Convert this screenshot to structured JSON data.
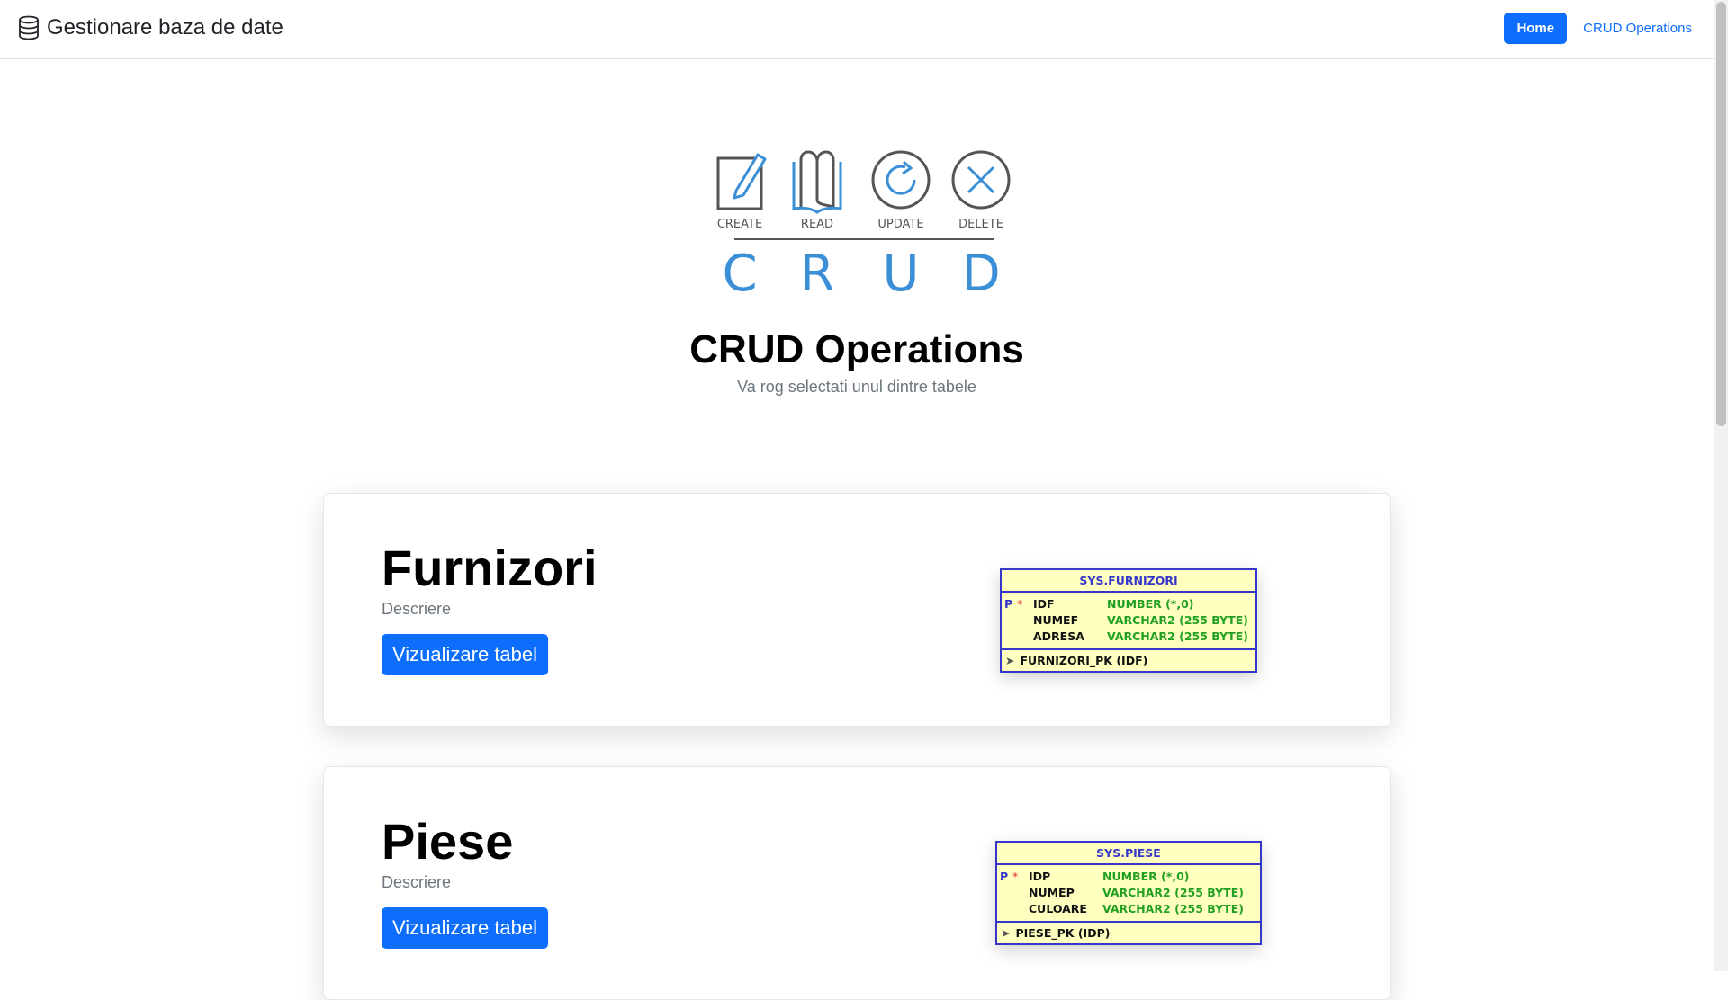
{
  "navbar": {
    "brand": "Gestionare baza de date",
    "brand_icon": "database-icon",
    "links": [
      {
        "label": "Home",
        "active": true
      },
      {
        "label": "CRUD Operations",
        "active": false
      }
    ]
  },
  "hero": {
    "logo": {
      "icons": [
        {
          "name": "pencil-square-icon",
          "label": "CREATE"
        },
        {
          "name": "book-icon",
          "label": "READ"
        },
        {
          "name": "refresh-icon",
          "label": "UPDATE"
        },
        {
          "name": "close-circle-icon",
          "label": "DELETE"
        }
      ],
      "letters": [
        "C",
        "R",
        "U",
        "D"
      ]
    },
    "title": "CRUD Operations",
    "subtitle": "Va rog selectati unul dintre tabele"
  },
  "cards": [
    {
      "title": "Furnizori",
      "description": "Descriere",
      "button": "Vizualizare tabel",
      "diagram": {
        "table": "SYS.FURNIZORI",
        "columns": [
          {
            "key": "P",
            "required": "*",
            "name": "IDF",
            "type": "NUMBER (*,0)"
          },
          {
            "key": "",
            "required": "",
            "name": "NUMEF",
            "type": "VARCHAR2 (255 BYTE)"
          },
          {
            "key": "",
            "required": "",
            "name": "ADRESA",
            "type": "VARCHAR2 (255 BYTE)"
          }
        ],
        "index": "FURNIZORI_PK (IDF)"
      }
    },
    {
      "title": "Piese",
      "description": "Descriere",
      "button": "Vizualizare tabel",
      "diagram": {
        "table": "SYS.PIESE",
        "columns": [
          {
            "key": "P",
            "required": "*",
            "name": "IDP",
            "type": "NUMBER (*,0)"
          },
          {
            "key": "",
            "required": "",
            "name": "NUMEP",
            "type": "VARCHAR2 (255 BYTE)"
          },
          {
            "key": "",
            "required": "",
            "name": "CULOARE",
            "type": "VARCHAR2 (255 BYTE)"
          }
        ],
        "index": "PIESE_PK (IDP)"
      }
    }
  ],
  "page_progress": 0.2,
  "colors": {
    "accent": "#0d6efd",
    "logo_blue": "#3a8fd6",
    "logo_gray": "#555555",
    "er_background": "#ffffc0",
    "er_border": "#3636c8",
    "er_type": "#22a022"
  }
}
